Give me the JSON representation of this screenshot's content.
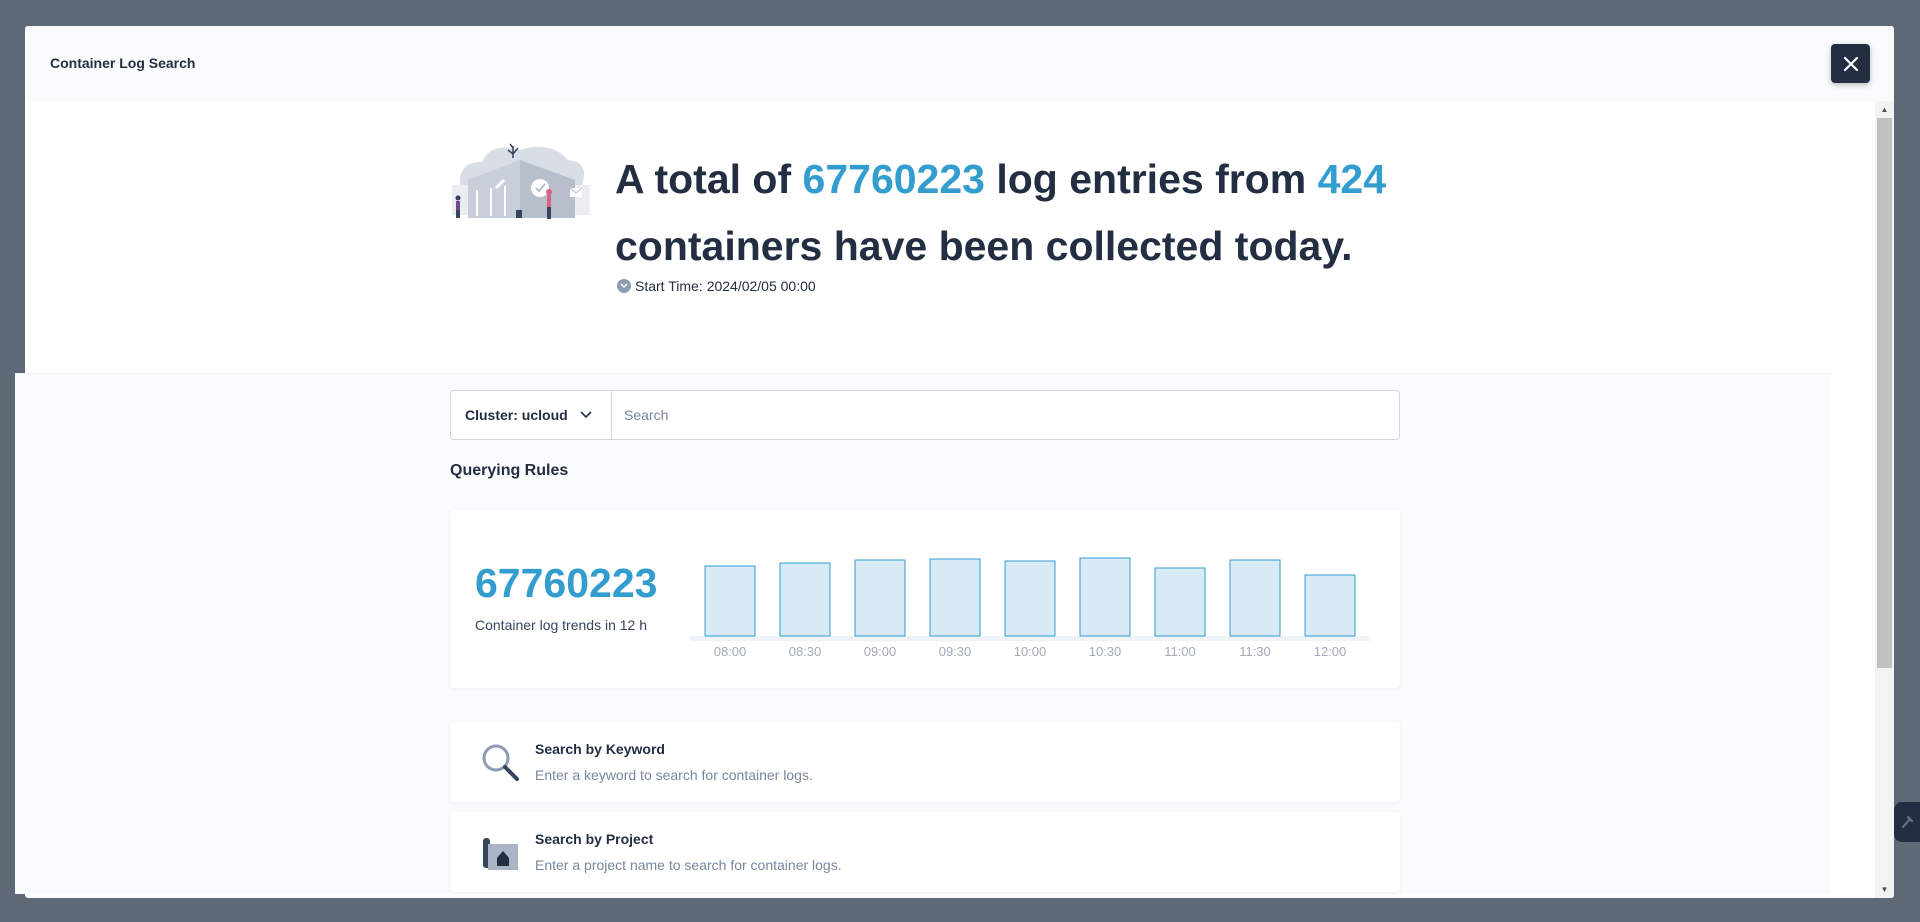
{
  "modal": {
    "title": "Container Log Search"
  },
  "hero": {
    "prefix": "A total of",
    "log_count": "67760223",
    "middle": "log entries from",
    "container_count": "424",
    "suffix": "containers have been collected today.",
    "start_time_label": "Start Time:",
    "start_time_value": "2024/02/05 00:00"
  },
  "search": {
    "cluster_label": "Cluster: ucloud",
    "placeholder": "Search"
  },
  "rules": {
    "title": "Querying Rules"
  },
  "trend": {
    "count": "67760223",
    "label": "Container log trends in 12 h"
  },
  "chart_data": {
    "type": "bar",
    "categories": [
      "08:00",
      "08:30",
      "09:00",
      "09:30",
      "10:00",
      "10:30",
      "11:00",
      "11:30",
      "12:00"
    ],
    "values": [
      70,
      73,
      76,
      77,
      75,
      78,
      68,
      76,
      61
    ],
    "ylim": [
      0,
      100
    ],
    "grid": false,
    "colors": {
      "fill": "#d7eaf5",
      "stroke": "#329dce"
    }
  },
  "options": [
    {
      "title": "Search by Keyword",
      "desc": "Enter a keyword to search for container logs.",
      "icon": "magnifier-icon"
    },
    {
      "title": "Search by Project",
      "desc": "Enter a project name to search for container logs.",
      "icon": "project-icon"
    }
  ],
  "colors": {
    "accent": "#329dce",
    "text": "#242e42",
    "overlay": "#5f6877"
  }
}
